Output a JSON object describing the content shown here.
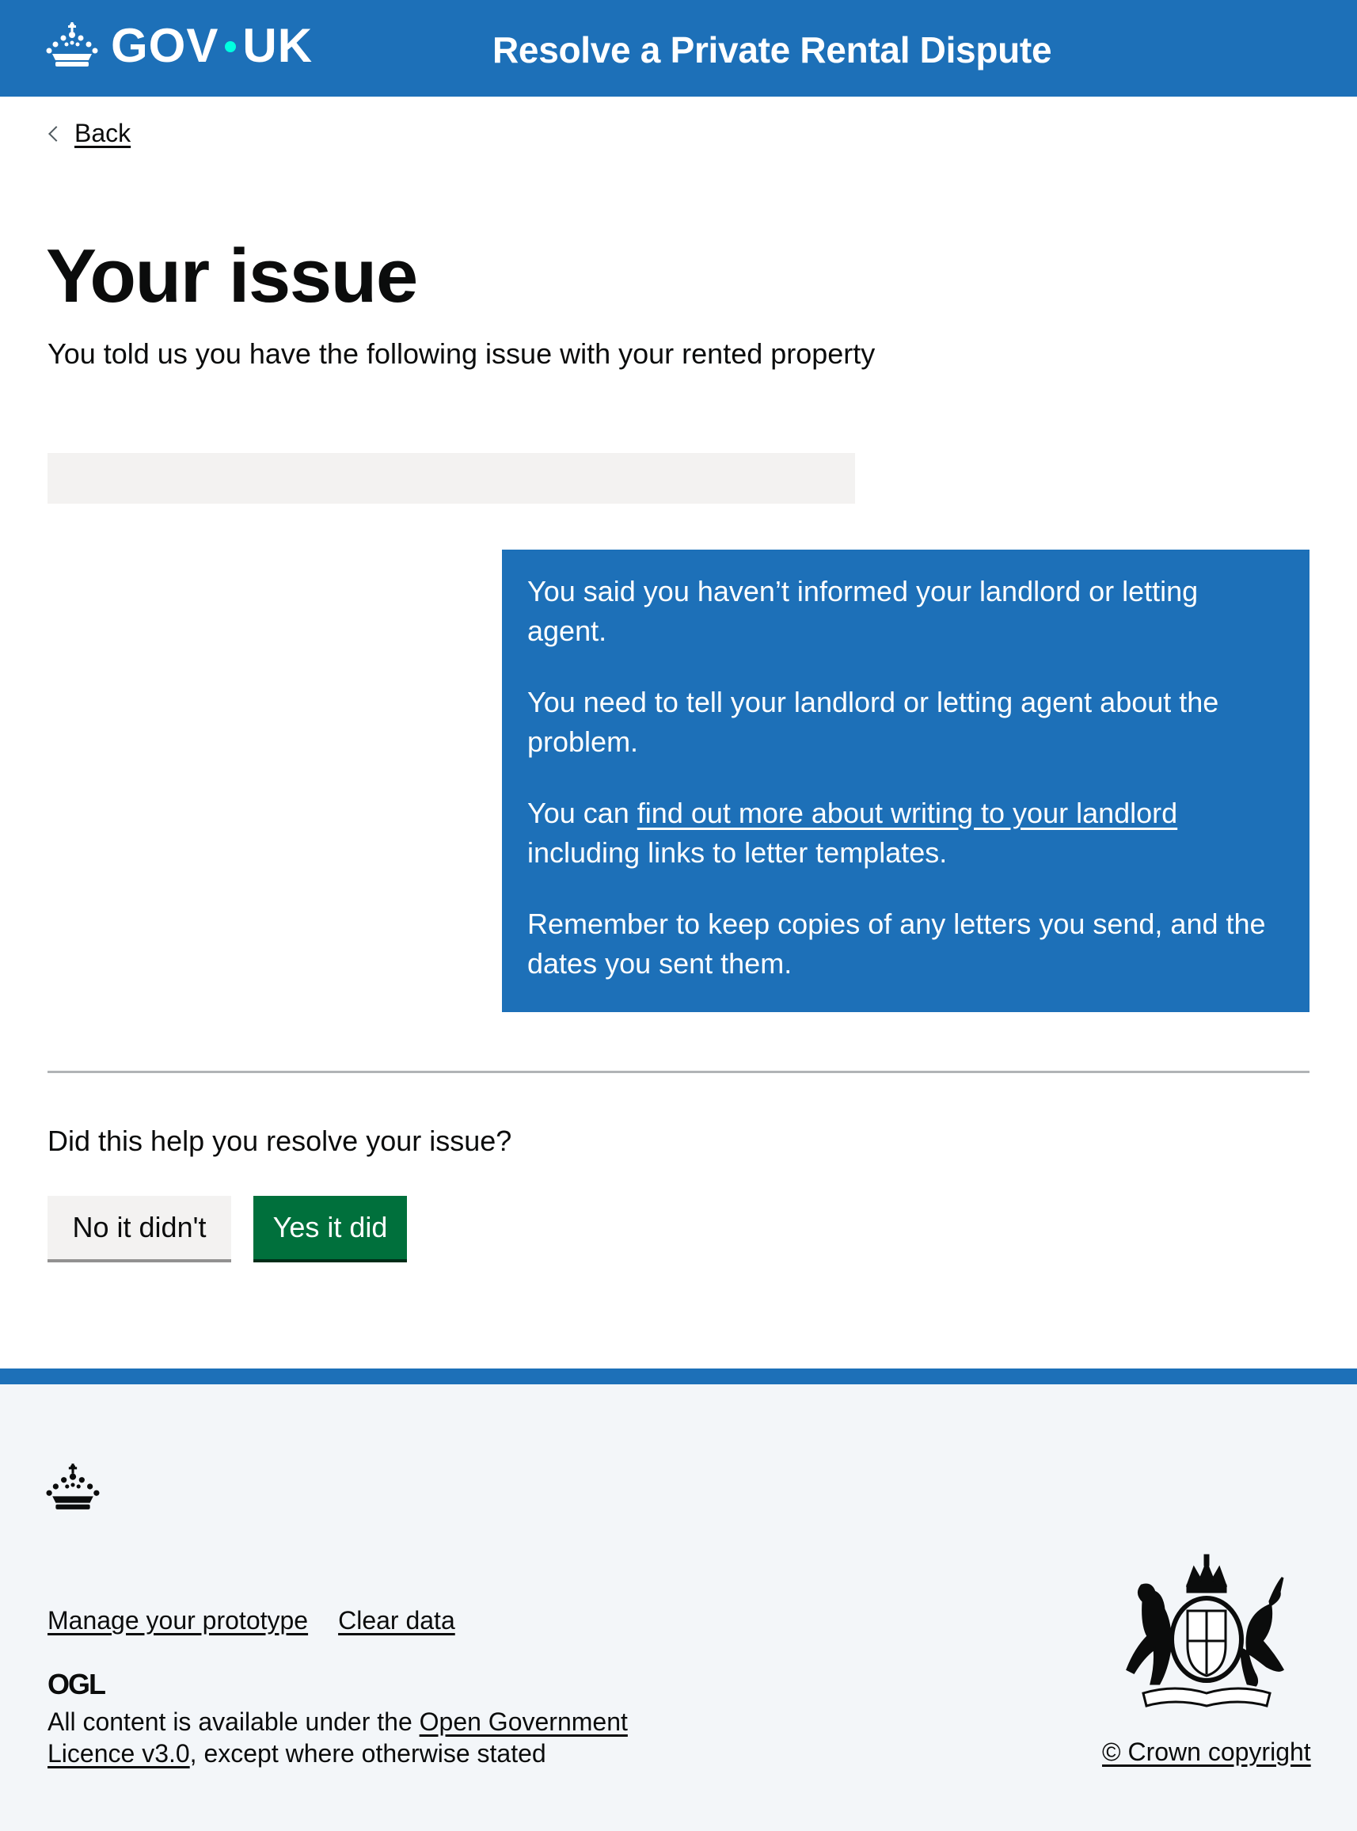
{
  "header": {
    "logo_text_left": "GOV",
    "logo_text_right": "UK",
    "service_name": "Resolve a Private Rental Dispute"
  },
  "back_link": "Back",
  "main": {
    "title": "Your issue",
    "lead": "You told us you have the following issue with your rented property",
    "panel": {
      "para1": "You said you haven’t informed your landlord or letting agent.",
      "para2": "You need to tell your landlord or letting agent about the problem.",
      "para3_prefix": "You can ",
      "para3_link": "find out more about writing to your landlord",
      "para3_suffix": " including links to letter templates.",
      "para4": "Remember to keep copies of any letters you send, and the dates you sent them."
    },
    "question": "Did this help you resolve your issue?",
    "btn_no": "No it didn't",
    "btn_yes": "Yes it did"
  },
  "footer": {
    "links": [
      "Manage your prototype",
      "Clear data"
    ],
    "ogl_text": "OGL",
    "licence_prefix": "All content is available under the ",
    "licence_link": "Open Government Licence v3.0",
    "licence_suffix": ", except where otherwise stated",
    "copyright": "© Crown copyright"
  },
  "colors": {
    "brand_blue": "#1d70b8",
    "button_green": "#00703c",
    "footer_bg": "#f3f6f9",
    "grey_bar": "#f3f2f1"
  }
}
